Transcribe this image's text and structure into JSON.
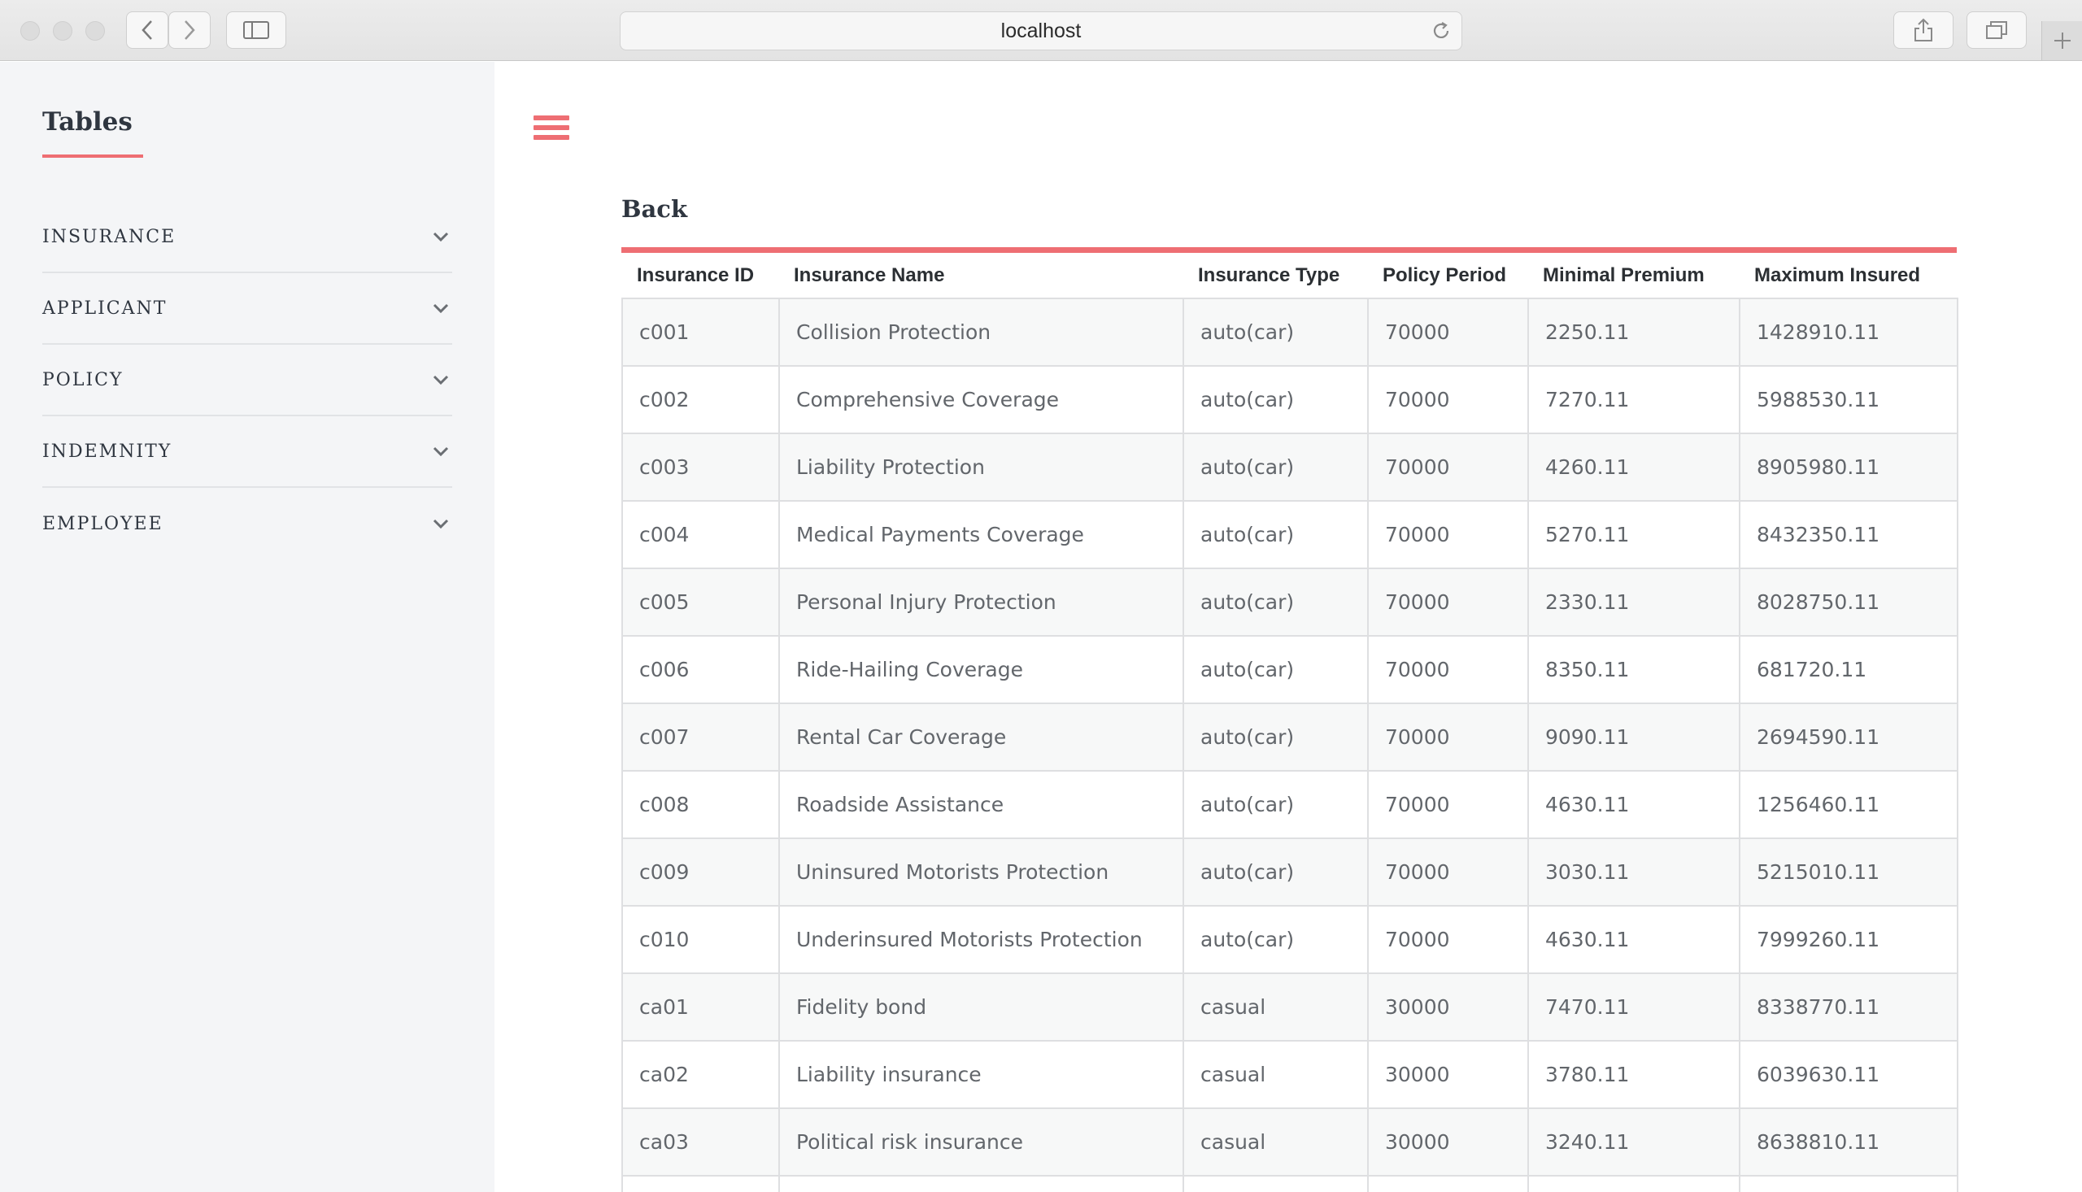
{
  "browser": {
    "address": "localhost"
  },
  "sidebar": {
    "title": "Tables",
    "items": [
      {
        "label": "INSURANCE"
      },
      {
        "label": "APPLICANT"
      },
      {
        "label": "POLICY"
      },
      {
        "label": "INDEMNITY"
      },
      {
        "label": "EMPLOYEE"
      }
    ]
  },
  "main": {
    "back_label": "Back",
    "accent_color": "#ee6e73",
    "table": {
      "headers": [
        "Insurance ID",
        "Insurance Name",
        "Insurance Type",
        "Policy Period",
        "Minimal Premium",
        "Maximum Insured"
      ],
      "rows": [
        [
          "c001",
          "Collision Protection",
          "auto(car)",
          "70000",
          "2250.11",
          "1428910.11"
        ],
        [
          "c002",
          "Comprehensive Coverage",
          "auto(car)",
          "70000",
          "7270.11",
          "5988530.11"
        ],
        [
          "c003",
          "Liability Protection",
          "auto(car)",
          "70000",
          "4260.11",
          "8905980.11"
        ],
        [
          "c004",
          "Medical Payments Coverage",
          "auto(car)",
          "70000",
          "5270.11",
          "8432350.11"
        ],
        [
          "c005",
          "Personal Injury Protection",
          "auto(car)",
          "70000",
          "2330.11",
          "8028750.11"
        ],
        [
          "c006",
          "Ride-Hailing Coverage",
          "auto(car)",
          "70000",
          "8350.11",
          "681720.11"
        ],
        [
          "c007",
          "Rental Car Coverage",
          "auto(car)",
          "70000",
          "9090.11",
          "2694590.11"
        ],
        [
          "c008",
          "Roadside Assistance",
          "auto(car)",
          "70000",
          "4630.11",
          "1256460.11"
        ],
        [
          "c009",
          "Uninsured Motorists Protection",
          "auto(car)",
          "70000",
          "3030.11",
          "5215010.11"
        ],
        [
          "c010",
          "Underinsured Motorists Protection",
          "auto(car)",
          "70000",
          "4630.11",
          "7999260.11"
        ],
        [
          "ca01",
          "Fidelity bond",
          "casual",
          "30000",
          "7470.11",
          "8338770.11"
        ],
        [
          "ca02",
          "Liability insurance",
          "casual",
          "30000",
          "3780.11",
          "6039630.11"
        ],
        [
          "ca03",
          "Political risk insurance",
          "casual",
          "30000",
          "3240.11",
          "8638810.11"
        ],
        [
          "",
          "",
          "",
          "",
          "",
          ""
        ]
      ]
    }
  }
}
